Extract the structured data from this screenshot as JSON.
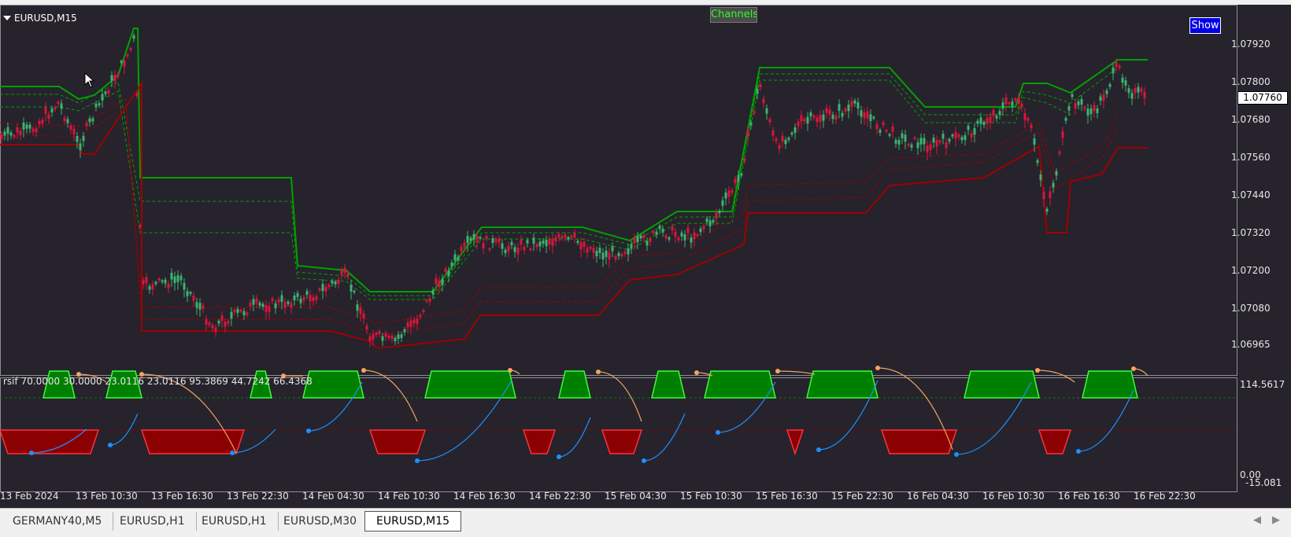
{
  "chart": {
    "symbol": "EURUSD,M15",
    "channels_label": "Channels",
    "show_button": "Show",
    "price_ticks": [
      "1.07920",
      "1.07800",
      "1.07680",
      "1.07560",
      "1.07440",
      "1.07320",
      "1.07200",
      "1.07080",
      "1.06965"
    ],
    "current_price": "1.07760"
  },
  "indicator": {
    "label": "rsif  70.0000 30.0000 23.0116 23.0116 95.3869 44.7242 66.4368",
    "scale_top": "114.5617",
    "scale_zero": "0.00",
    "scale_bottom": "-15.081"
  },
  "time_axis": [
    "13 Feb 2024",
    "13 Feb 10:30",
    "13 Feb 16:30",
    "13 Feb 22:30",
    "14 Feb 04:30",
    "14 Feb 10:30",
    "14 Feb 16:30",
    "14 Feb 22:30",
    "15 Feb 04:30",
    "15 Feb 10:30",
    "15 Feb 16:30",
    "15 Feb 22:30",
    "16 Feb 04:30",
    "16 Feb 10:30",
    "16 Feb 16:30",
    "16 Feb 22:30"
  ],
  "tabs": [
    {
      "label": "GERMANY40,M5",
      "active": false
    },
    {
      "label": "EURUSD,H1",
      "active": false
    },
    {
      "label": "EURUSD,H1",
      "active": false
    },
    {
      "label": "EURUSD,M30",
      "active": false
    },
    {
      "label": "EURUSD,M15",
      "active": true
    }
  ],
  "colors": {
    "background": "#26232c",
    "upper_channel": "#00a000",
    "lower_channel": "#a00000",
    "bull_candle": "#3cb371",
    "bear_candle": "#dc143c",
    "overbought_fill": "#008000",
    "oversold_fill": "#8b0000",
    "rsi_blue": "#1e90ff",
    "rsi_orange": "#f4a460"
  }
}
